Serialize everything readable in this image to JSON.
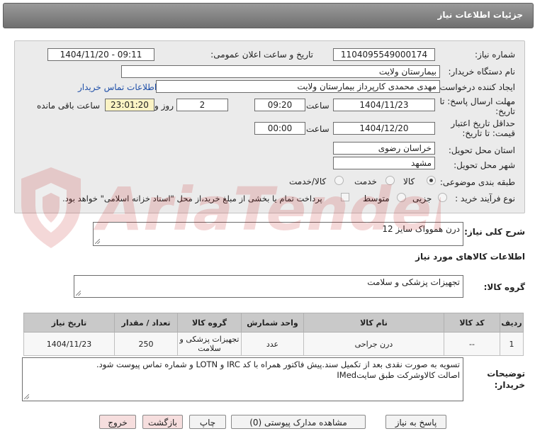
{
  "header": {
    "title": "جزئیات اطلاعات نیاز"
  },
  "form": {
    "need_number_label": "شماره نیاز:",
    "need_number": "1104095549000174",
    "announce_label": "تاریخ و ساعت اعلان عمومی:",
    "announce_value": "1404/11/20 - 09:11",
    "buyer_label": "نام دستگاه خریدار:",
    "buyer_value": "بیمارستان ولایت",
    "creator_label": "ایجاد کننده درخواست:",
    "creator_value": "مهدی محمدی کارپرداز بیمارستان ولایت",
    "contact_link": "اطلاعات تماس خریدار",
    "deadline_label_1": "مهلت ارسال پاسخ: تا",
    "deadline_label_2": "تاریخ:",
    "deadline_date": "1404/11/23",
    "time_label": "ساعت",
    "deadline_time": "09:20",
    "days_value": "2",
    "days_label": "روز و",
    "remaining_time": "23:01:20",
    "remaining_label": "ساعت باقی مانده",
    "validity_label_1": "حداقل تاریخ اعتبار",
    "validity_label_2": "قیمت: تا تاریخ:",
    "validity_date": "1404/12/20",
    "validity_time": "00:00",
    "province_label": "استان محل تحویل:",
    "province_value": "خراسان رضوی",
    "city_label": "شهر محل تحویل:",
    "city_value": "مشهد",
    "category_label": "طبقه بندی موضوعی:",
    "category_options": [
      "کالا",
      "خدمت",
      "کالا/خدمت"
    ],
    "process_label": "نوع فرآیند خرید :",
    "process_options": [
      "جزیی",
      "متوسط"
    ],
    "payment_note": "پرداخت تمام یا بخشی از مبلغ خرید،از محل \"اسناد خزانه اسلامی\" خواهد بود."
  },
  "summary": {
    "label": "شرح کلی نیاز:",
    "value": "درن هموواک سایز 12"
  },
  "goods_info_title": "اطلاعات کالاهای مورد نیاز",
  "goods_group": {
    "label": "گروه کالا:",
    "value": "تجهیزات پزشکی و سلامت"
  },
  "table": {
    "headers": [
      "ردیف",
      "کد کالا",
      "نام کالا",
      "واحد شمارش",
      "گروه کالا",
      "تعداد / مقدار",
      "تاریخ نیاز"
    ],
    "rows": [
      [
        "1",
        "--",
        "درن جراحی",
        "عدد",
        "تجهیزات پزشکی و سلامت",
        "250",
        "1404/11/23"
      ]
    ]
  },
  "buyer_notes": {
    "label_1": "توضیحات",
    "label_2": "خریدار:",
    "line_1": "تسویه به صورت نقدی بعد از تکمیل سند.پیش فاکتور همراه با کد IRC و LOTN و شماره تماس پیوست شود.",
    "line_2": "اصالت کالاوشرکت طبق سایتIMed"
  },
  "buttons": {
    "reply": "پاسخ به نیاز",
    "attachments": "مشاهده مدارک پیوستی (0)",
    "print": "چاپ",
    "back": "بازگشت",
    "exit": "خروج"
  },
  "watermark_text": "AriaTender.net",
  "colors": {
    "header": "#7f7f7f",
    "panel": "#ebebeb",
    "link": "#1f4fa8",
    "remaining": "#fbf3c4",
    "pink_button": "#f6dede"
  }
}
